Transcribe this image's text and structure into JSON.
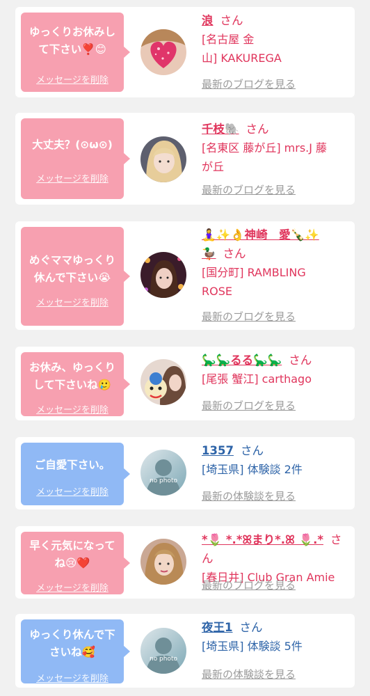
{
  "delete_label": "メッセージを削除",
  "san": "さん",
  "cards": [
    {
      "message": "ゆっくりお休みし\nて下さい❣️😊",
      "name": "浪",
      "shop": "[名古屋 金\n山] KAKUREGA",
      "more": "最新のブログを見る",
      "avatar_icon": "heart-sticker-photo",
      "theme": "pink"
    },
    {
      "message": "大丈夫？(⊙ω⊙)",
      "name": "千枝🐘",
      "shop": "[名東区 藤が丘] mrs.J 藤\nが丘",
      "more": "最新のブログを見る",
      "avatar_icon": "profile-photo",
      "theme": "pink"
    },
    {
      "message": "めぐママゆっくり\n休んで下さい😭",
      "name": "🧘‍♀️✨👌神崎　愛🍾✨\n🦆",
      "shop": "[国分町] RAMBLING\nROSE",
      "more": "最新のブログを見る",
      "avatar_icon": "profile-photo",
      "theme": "pink"
    },
    {
      "message": "お休み、ゆっくり\nして下さいね🥲",
      "name": "🦕🦕るる🦕🦕",
      "shop": "[尾張 蟹江] carthago",
      "more": "最新のブログを見る",
      "avatar_icon": "profile-photo",
      "theme": "pink"
    },
    {
      "message": "ご自愛下さい。",
      "name": "1357",
      "shop": "[埼玉県] 体験談 2件",
      "more": "最新の体験談を見る",
      "avatar_icon": "no-photo-silhouette",
      "no_photo": "no photo",
      "theme": "blue"
    },
    {
      "message": "早く元気になって\nね😢❤️",
      "name": "*🌷 *.*ꕤまり*.ꕤ 🌷.*",
      "shop": "[春日井] Club Gran Amie",
      "more": "最新のブログを見る",
      "avatar_icon": "profile-photo",
      "theme": "pink"
    },
    {
      "message": "ゆっくり休んで下\nさいね🥰",
      "name": "夜王1",
      "shop": "[埼玉県] 体験談 5件",
      "more": "最新の体験談を見る",
      "avatar_icon": "no-photo-silhouette",
      "no_photo": "no photo",
      "theme": "blue"
    }
  ],
  "colors": {
    "pink_bubble": "#f7a0b0",
    "blue_bubble": "#90b9f5",
    "pink_text": "#e0355c",
    "blue_text": "#2e64a8"
  }
}
